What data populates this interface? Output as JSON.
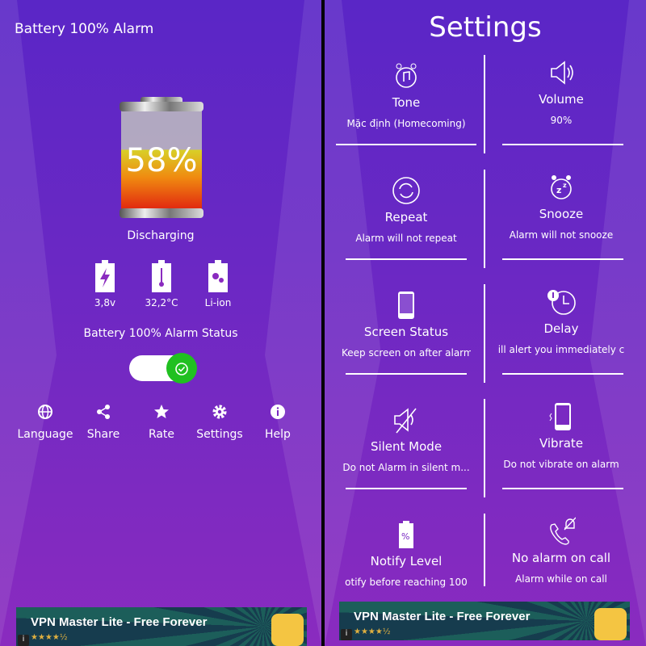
{
  "main": {
    "app_title": "Battery 100% Alarm",
    "battery_percent": "58%",
    "battery_level": 58,
    "status": "Discharging",
    "stats": [
      {
        "icon": "voltage-icon",
        "value": "3,8v"
      },
      {
        "icon": "temperature-icon",
        "value": "32,2°C"
      },
      {
        "icon": "technology-icon",
        "value": "Li-ion"
      }
    ],
    "alarm_status_label": "Battery 100% Alarm Status",
    "alarm_enabled": true,
    "menu": [
      {
        "icon": "globe-icon",
        "label": "Language"
      },
      {
        "icon": "share-icon",
        "label": "Share"
      },
      {
        "icon": "star-icon",
        "label": "Rate"
      },
      {
        "icon": "gear-icon",
        "label": "Settings"
      },
      {
        "icon": "info-icon",
        "label": "Help"
      }
    ]
  },
  "ad": {
    "title": "VPN Master Lite - Free Forever",
    "stars": "★★★★½",
    "info": "i"
  },
  "settings": {
    "title": "Settings",
    "items": [
      {
        "icon": "alarm-tone-icon",
        "title": "Tone",
        "subtitle": "Mặc định (Homecoming)"
      },
      {
        "icon": "volume-icon",
        "title": "Volume",
        "subtitle": "90%"
      },
      {
        "icon": "repeat-icon",
        "title": "Repeat",
        "subtitle": "Alarm will not repeat"
      },
      {
        "icon": "snooze-icon",
        "title": "Snooze",
        "subtitle": "Alarm will not snooze"
      },
      {
        "icon": "phone-screen-icon",
        "title": "Screen Status",
        "subtitle": "Keep screen on after alarm"
      },
      {
        "icon": "delay-clock-icon",
        "title": "Delay",
        "subtitle": "ill alert you immediately c"
      },
      {
        "icon": "silent-mode-icon",
        "title": "Silent Mode",
        "subtitle": "Do not Alarm in silent m..."
      },
      {
        "icon": "vibrate-icon",
        "title": "Vibrate",
        "subtitle": "Do not vibrate on alarm"
      },
      {
        "icon": "battery-percent-icon",
        "title": "Notify Level",
        "subtitle": "otify before reaching 100"
      },
      {
        "icon": "no-alarm-call-icon",
        "title": "No alarm on call",
        "subtitle": "Alarm while on call"
      }
    ]
  },
  "colors": {
    "bg_top": "#5a26c6",
    "bg_bottom": "#8a2bbf",
    "toggle_on": "#20c020"
  }
}
